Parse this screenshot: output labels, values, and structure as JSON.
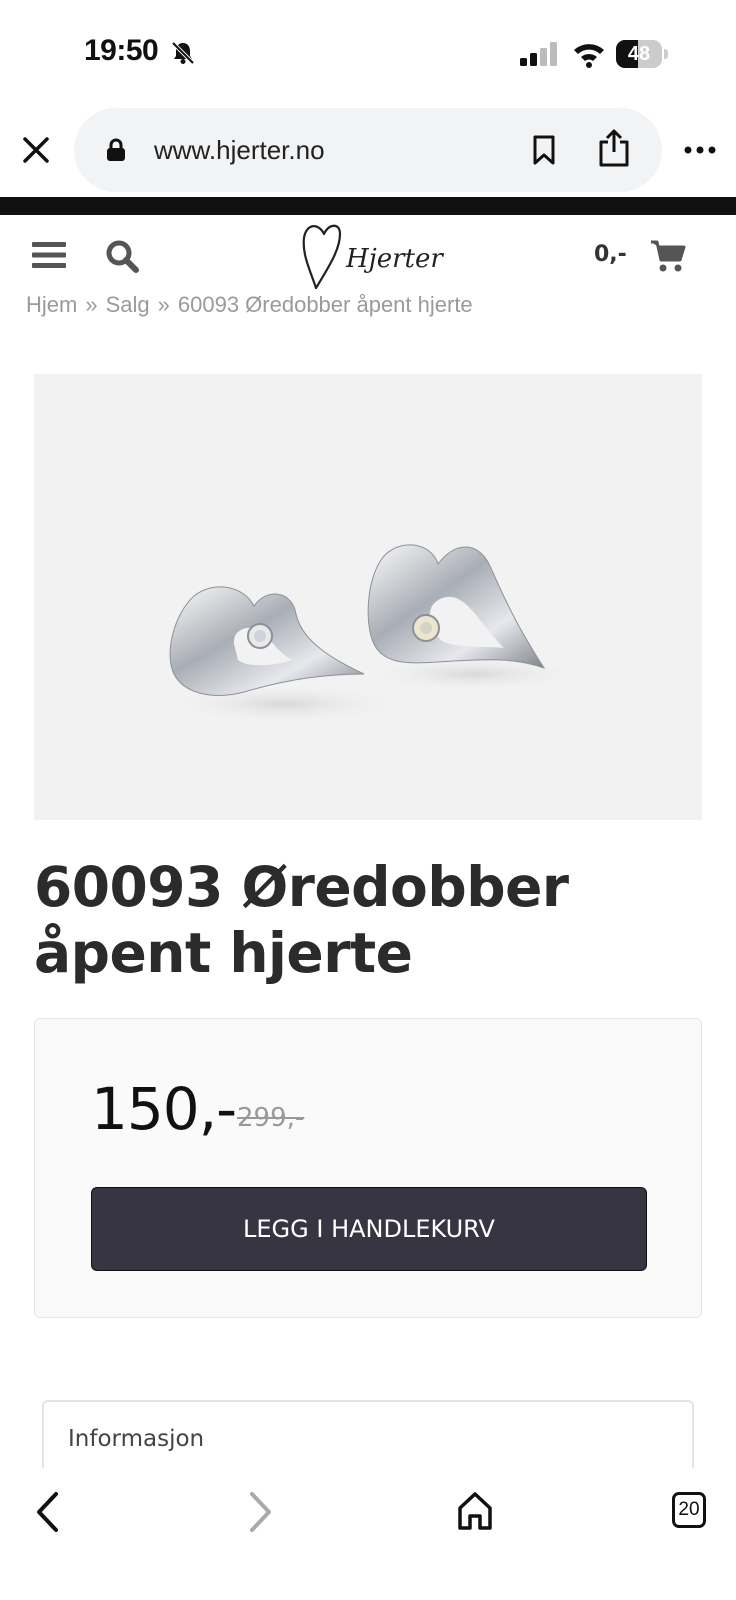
{
  "status_bar": {
    "time": "19:50",
    "battery_percent": 48,
    "battery_level": 0.48
  },
  "browser": {
    "url": "www.hjerter.no",
    "tab_count": "20"
  },
  "site": {
    "logo_text": "Hjerter",
    "cart_total": "0,-"
  },
  "breadcrumb": {
    "items": [
      "Hjem",
      "Salg",
      "60093 Øredobber åpent hjerte"
    ],
    "separator": "»"
  },
  "product": {
    "title": "60093 Øredobber åpent hjerte",
    "price": "150,-",
    "old_price": "299,-",
    "add_to_cart_label": "LEGG I HANDLEKURV"
  },
  "info": {
    "title": "Informasjon"
  },
  "colors": {
    "button_bg": "#383542",
    "image_bg": "#f2f2f2",
    "breadcrumb": "#9a9a9a"
  },
  "icons": [
    "bell-slash-icon",
    "signal-icon",
    "wifi-icon",
    "close-icon",
    "lock-icon",
    "bookmark-icon",
    "share-icon",
    "more-icon",
    "menu-icon",
    "search-icon",
    "cart-icon",
    "back-icon",
    "forward-icon",
    "home-icon"
  ]
}
